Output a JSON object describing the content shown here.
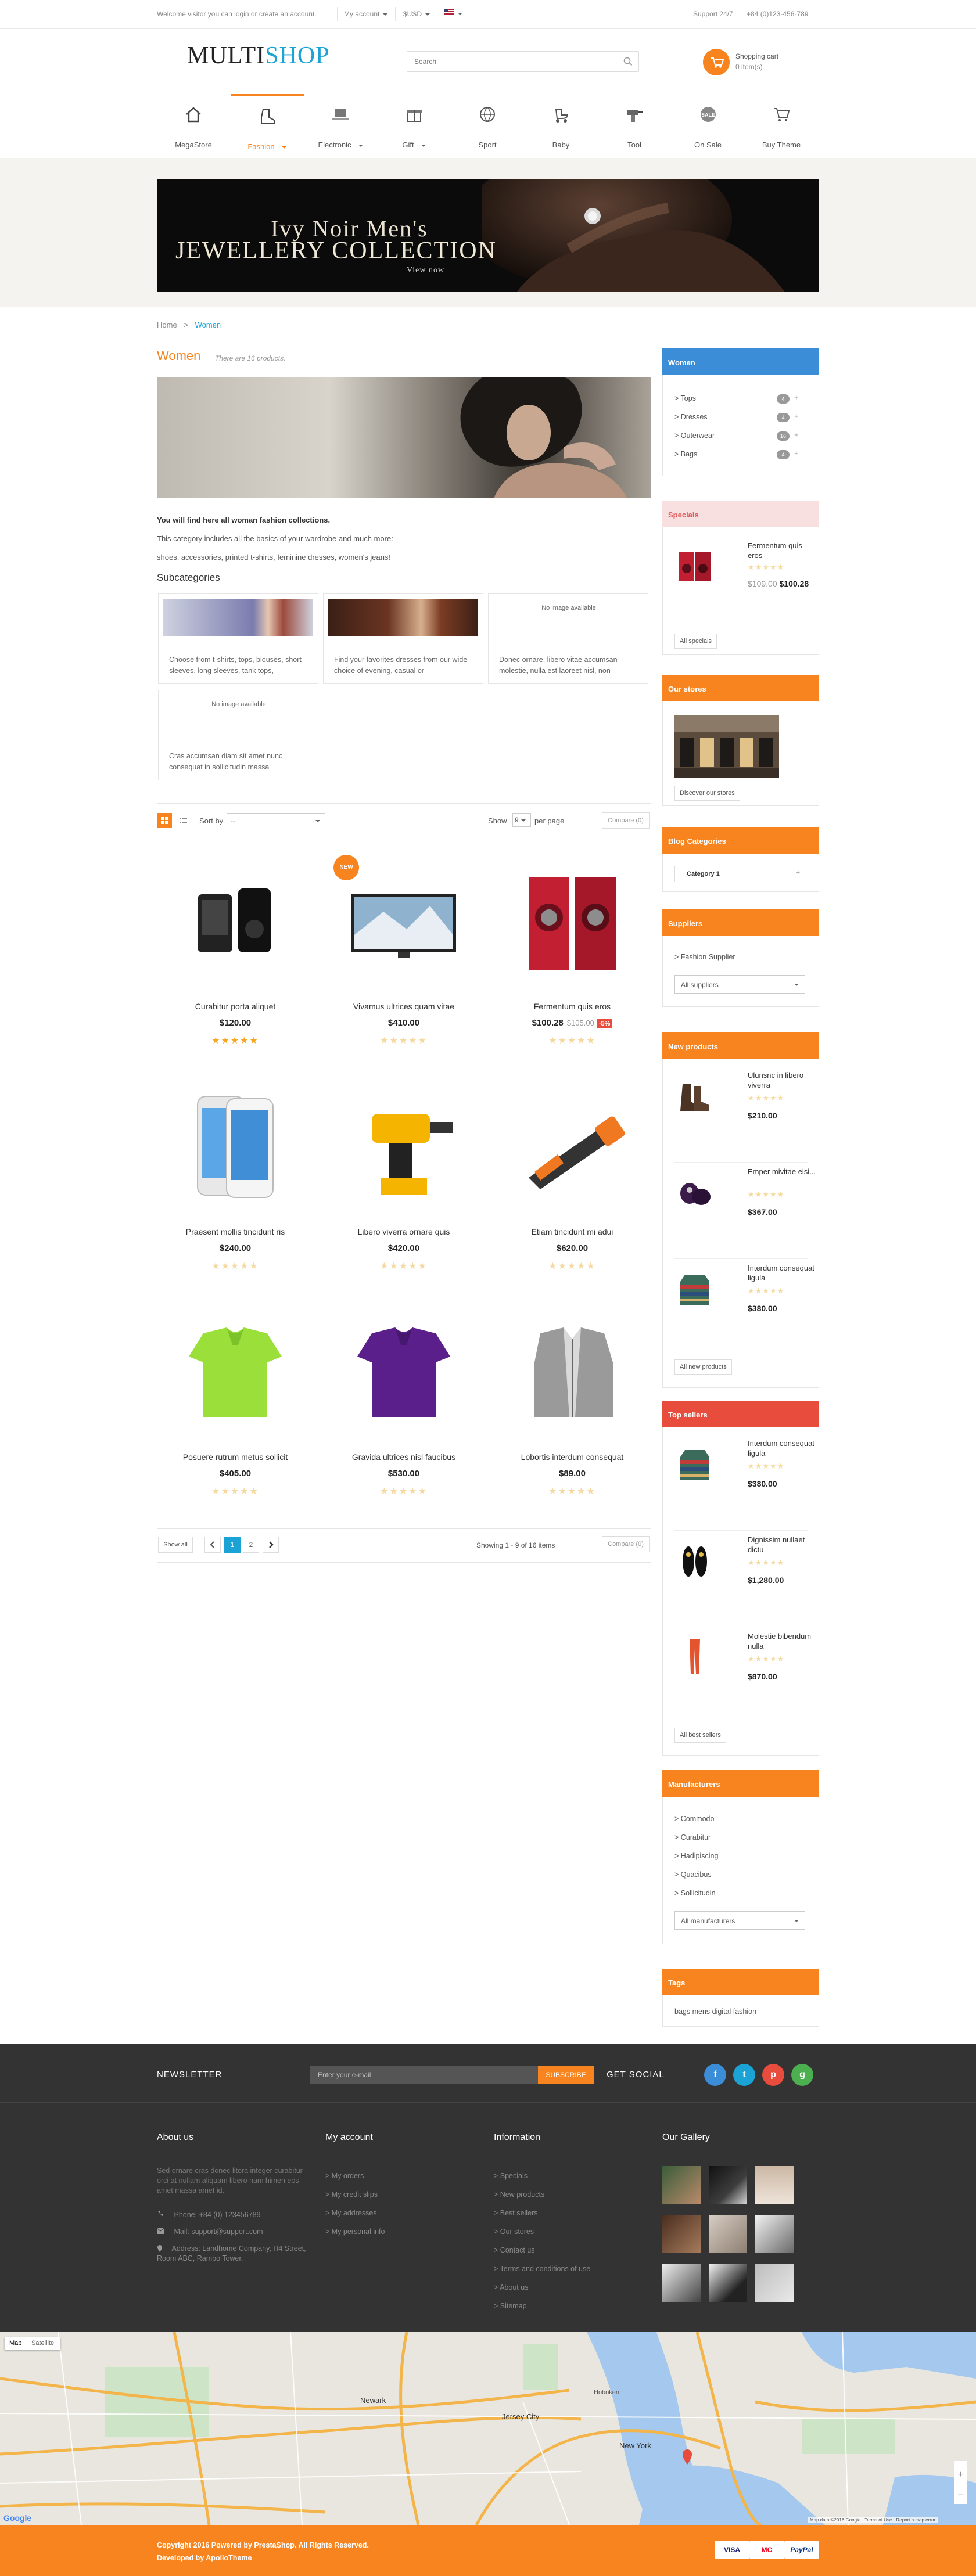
{
  "topbar": {
    "welcome": "Welcome visitor you can login or create an account.",
    "my_account": "My account",
    "currency": "$USD",
    "support": "Support 24/7",
    "phone": "+84 (0)123-456-789"
  },
  "header": {
    "logo_a": "MULTI",
    "logo_b": "SHOP",
    "search_placeholder": "Search",
    "cart_title": "Shopping cart",
    "cart_items": "0 item(s)"
  },
  "nav": [
    {
      "label": "MegaStore",
      "icon": "home-icon"
    },
    {
      "label": "Fashion",
      "icon": "boot-icon",
      "active": true,
      "caret": true
    },
    {
      "label": "Electronic",
      "icon": "laptop-icon",
      "caret": true
    },
    {
      "label": "Gift",
      "icon": "gift-icon",
      "caret": true
    },
    {
      "label": "Sport",
      "icon": "ball-icon"
    },
    {
      "label": "Baby",
      "icon": "stroller-icon"
    },
    {
      "label": "Tool",
      "icon": "drill-icon"
    },
    {
      "label": "On Sale",
      "icon": "sale-icon"
    },
    {
      "label": "Buy Theme",
      "icon": "cart-icon"
    }
  ],
  "banner": {
    "line1": "Ivy Noir Men's",
    "line2": "Jewellery Collection",
    "line3": "View now"
  },
  "breadcrumb": {
    "home": "Home",
    "sep": ">",
    "current": "Women"
  },
  "category": {
    "title": "Women",
    "count": "There are 16 products.",
    "desc_bold": "You will find here all woman fashion collections.",
    "desc_2": "This category includes all the basics of your wardrobe and much more:",
    "desc_3": "shoes, accessories, printed t-shirts, feminine dresses, women's jeans!",
    "subcategories_title": "Subcategories",
    "noimage": "No image available",
    "subcategories": [
      {
        "text": "Choose from t-shirts, tops, blouses, short sleeves, long sleeves, tank tops,"
      },
      {
        "text": "Find your favorites dresses from our wide choice of evening, casual or"
      },
      {
        "text": "Donec ornare, libero vitae accumsan molestie, nulla est laoreet nisl, non"
      },
      {
        "text": "Cras accumsan diam sit amet nunc consequat in sollicitudin massa"
      }
    ]
  },
  "toolbar": {
    "sort_label": "Sort by",
    "sort_value": "--",
    "show_label": "Show",
    "show_value": "9",
    "per_page": "per page",
    "compare": "Compare (0)"
  },
  "new_badge": "NEW",
  "products": [
    {
      "name": "Curabitur porta aliquet",
      "price": "$120.00",
      "stars": 5
    },
    {
      "name": "Vivamus ultrices quam vitae",
      "price": "$410.00",
      "stars": 0
    },
    {
      "name": "Fermentum quis eros",
      "price": "$100.28",
      "old": "$105.00",
      "disc": "-5%",
      "stars": 0
    },
    {
      "name": "Praesent mollis tincidunt ris",
      "price": "$240.00",
      "stars": 0
    },
    {
      "name": "Libero viverra ornare quis",
      "price": "$420.00",
      "stars": 0
    },
    {
      "name": "Etiam tincidunt mi adui",
      "price": "$620.00",
      "stars": 0
    },
    {
      "name": "Posuere rutrum metus sollicit",
      "price": "$405.00",
      "stars": 0
    },
    {
      "name": "Gravida ultrices nisl faucibus",
      "price": "$530.00",
      "stars": 0
    },
    {
      "name": "Lobortis interdum consequat",
      "price": "$89.00",
      "stars": 0
    }
  ],
  "pagination": {
    "show_all": "Show all",
    "pages": [
      "1",
      "2"
    ],
    "showing": "Showing 1 - 9 of 16 items",
    "compare": "Compare (0)"
  },
  "sidebar": {
    "women": {
      "title": "Women",
      "items": [
        {
          "label": "> Tops",
          "count": "4"
        },
        {
          "label": "> Dresses",
          "count": "4"
        },
        {
          "label": "> Outerwear",
          "count": "16"
        },
        {
          "label": "> Bags",
          "count": "4"
        }
      ]
    },
    "specials": {
      "title": "Specials",
      "name": "Fermentum quis eros",
      "old": "$109.00",
      "price": "$100.28",
      "btn": "All specials"
    },
    "stores": {
      "title": "Our stores",
      "btn": "Discover our stores"
    },
    "blog": {
      "title": "Blog Categories",
      "item": "Category 1"
    },
    "suppliers": {
      "title": "Suppliers",
      "item": "> Fashion Supplier",
      "select": "All suppliers"
    },
    "new_products": {
      "title": "New products",
      "items": [
        {
          "name": "Ulunsnc in libero viverra",
          "price": "$210.00"
        },
        {
          "name": "Emper mivitae eisi...",
          "price": "$367.00"
        },
        {
          "name": "Interdum consequat ligula",
          "price": "$380.00"
        }
      ],
      "btn": "All new products"
    },
    "top_sellers": {
      "title": "Top sellers",
      "items": [
        {
          "name": "Interdum consequat ligula",
          "price": "$380.00"
        },
        {
          "name": "Dignissim nullaet dictu",
          "price": "$1,280.00"
        },
        {
          "name": "Molestie bibendum nulla",
          "price": "$870.00"
        }
      ],
      "btn": "All best sellers"
    },
    "manufacturers": {
      "title": "Manufacturers",
      "items": [
        "> Commodo",
        "> Curabitur",
        "> Hadipiscing",
        "> Quacibus",
        "> Sollicitudin"
      ],
      "select": "All manufacturers"
    },
    "tags": {
      "title": "Tags",
      "text": "bags mens digital fashion"
    }
  },
  "footer": {
    "newsletter": "NEWSLETTER",
    "email_placeholder": "Enter your e-mail",
    "subscribe": "SUBSCRIBE",
    "get_social": "GET SOCIAL",
    "about_title": "About us",
    "about_text": "Sed ornare cras donec litora integer curabitur orci at nullam aliquam libero nam himen eos amet massa amet id.",
    "phone": "Phone: +84 (0) 123456789",
    "mail": "Mail: support@support.com",
    "address": "Address: Landhome Company, H4 Street, Room ABC, Rambo Tower.",
    "account_title": "My account",
    "account_links": [
      "> My orders",
      "> My credit slips",
      "> My addresses",
      "> My personal info"
    ],
    "info_title": "Information",
    "info_links": [
      "> Specials",
      "> New products",
      "> Best sellers",
      "> Our stores",
      "> Contact us",
      "> Terms and conditions of use",
      "> About us",
      "> Sitemap"
    ],
    "gallery_title": "Our Gallery"
  },
  "map": {
    "map_btn": "Map",
    "sat_btn": "Satellite",
    "labels": [
      "Newark",
      "Jersey City",
      "New York",
      "Hoboken"
    ],
    "google": "Google",
    "terms": "Map data ©2016 Google · Terms of Use · Report a map error"
  },
  "bottom": {
    "copy1": "Copyright 2016 Powered by PrestaShop. All Rights Reserved.",
    "copy2": "Developed by ApolloTheme",
    "payments": [
      "VISA",
      "MC",
      "PayPal"
    ]
  },
  "colors": {
    "accent": "#f7841e",
    "link": "#1ba3d6",
    "blue_head": "#3b8dd8",
    "red_head": "#e74c3c"
  }
}
